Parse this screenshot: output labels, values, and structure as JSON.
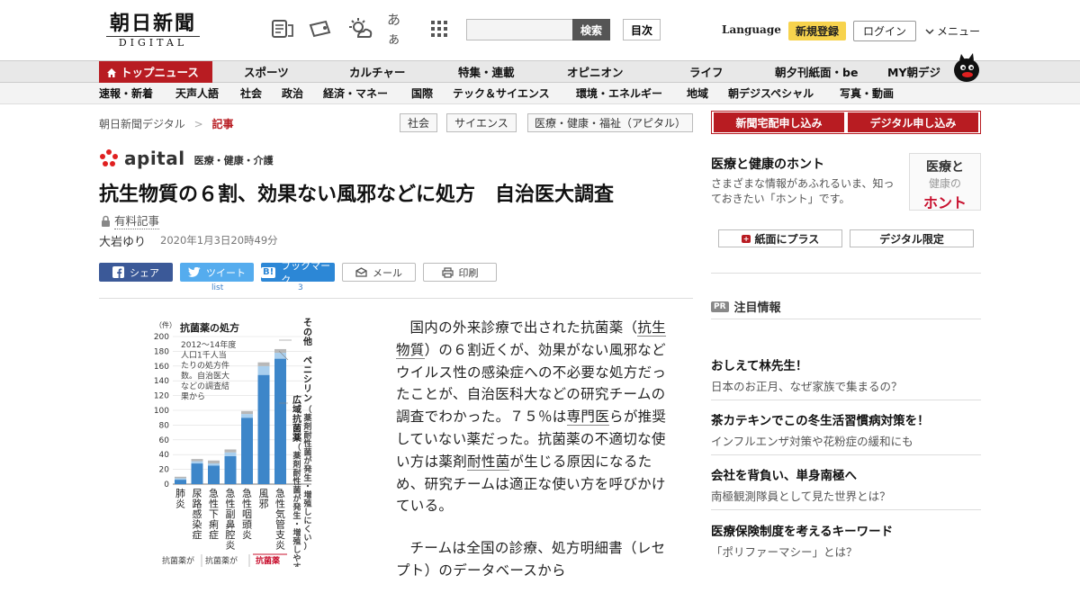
{
  "header": {
    "logo_ja": "朝日新聞",
    "logo_en": "DIGITAL",
    "search_button": "検索",
    "search_placeholder": "",
    "toc_button": "目次",
    "language": "Language",
    "register_button": "新規登録",
    "login_button": "ログイン",
    "menu_button": "メニュー",
    "lang_icon_glyph": "あぁ"
  },
  "nav_primary": [
    "トップニュース",
    "スポーツ",
    "カルチャー",
    "特集・連載",
    "オピニオン",
    "ライフ",
    "朝夕刊紙面・be",
    "MY朝デジ"
  ],
  "nav_secondary": [
    "速報・新着",
    "天声人語",
    "社会",
    "政治",
    "経済・マネー",
    "国際",
    "テック＆サイエンス",
    "環境・エネルギー",
    "地域",
    "朝デジスペシャル",
    "写真・動画"
  ],
  "breadcrumb": {
    "site": "朝日新聞デジタル",
    "sep": ">",
    "current": "記事"
  },
  "tags": [
    "社会",
    "サイエンス",
    "医療・健康・福祉（アピタル）"
  ],
  "apital": {
    "word": "apital",
    "sub": "医療・健康・介護"
  },
  "article": {
    "headline": "抗生物質の６割、効果ない風邪などに処方　自治医大調査",
    "paid_label": "有料記事",
    "author": "大岩ゆり",
    "date": "2020年1月3日20時49分",
    "para1_a": "国内の外来診療で出された抗菌薬（",
    "para1_link1": "抗生物質",
    "para1_b": "）の６割近くが、効果がない風邪などウイルス性の感染症への不必要な処方だったことが、自治医科大などの研究チームの調査でわかった。７５％は",
    "para1_link2": "専門医",
    "para1_c": "らが推奨していない薬だった。抗菌薬の不適切な使い方は薬剤",
    "para1_link3": "耐性菌",
    "para1_d": "が生じる原因になるため、研究チームは適正な使い方を呼びかけている。",
    "para2": "チームは全国の診療、処方明細書（レセプト）のデータベースから"
  },
  "share": {
    "facebook": "シェア",
    "twitter": "ツイート",
    "hatena": "ブックマーク",
    "mail": "メール",
    "print": "印刷",
    "twitter_count": "list",
    "hatena_count": "3"
  },
  "chart_data": {
    "type": "bar",
    "title": "抗菌薬の処方",
    "unit": "（件）",
    "note": [
      "2012～14年度",
      "人口1千人当",
      "たりの処方件",
      "数。自治医大",
      "などの調査結",
      "果から"
    ],
    "ylim": [
      0,
      200
    ],
    "yticks": [
      0,
      20,
      40,
      60,
      80,
      100,
      120,
      140,
      160,
      180,
      200
    ],
    "categories": [
      "肺炎",
      "尿路感染症",
      "急性下痢症",
      "急性副鼻腔炎",
      "急性咽頭炎",
      "風邪",
      "急性気管支炎"
    ],
    "series": [
      {
        "name": "広域抗菌薬",
        "values": [
          6,
          28,
          25,
          38,
          90,
          148,
          170
        ]
      },
      {
        "name": "ペニシリン",
        "values": [
          2,
          3,
          3,
          5,
          5,
          12,
          8
        ]
      },
      {
        "name": "その他",
        "values": [
          2,
          3,
          4,
          4,
          4,
          5,
          5
        ]
      }
    ],
    "legend_labels": {
      "other": "その他",
      "penicillin": "ペニシリン",
      "penicillin_note": "（薬剤耐性菌が発生・増殖しにくい）",
      "broad": "広域抗菌薬",
      "broad_note": "（薬剤耐性菌が発生・増殖しやすい）"
    },
    "bottom_labels": [
      "抗菌薬が",
      "抗菌薬が",
      "抗菌薬"
    ],
    "colors": {
      "broad": "#3d86c9",
      "penicillin": "#a9cfee",
      "other": "#b8b8b8",
      "highlight": "#c8102e"
    }
  },
  "sidebar": {
    "subscribe_paper": "新聞宅配申し込み",
    "subscribe_digital": "デジタル申し込み",
    "honto_title": "医療と健康のホント",
    "honto_desc": "さまざまな情報があふれるいま、知っておきたい「ホント」です。",
    "honto_logo_1": "医療と",
    "honto_logo_2": "健康の",
    "honto_logo_3": "ホント",
    "plus_button": "紙面にプラス",
    "digital_only_button": "デジタル限定",
    "pr_badge": "PR",
    "pr_heading": "注目情報",
    "pr_items": [
      {
        "title": "おしえて林先生！",
        "sub": "日本のお正月、なぜ家族で集まるの？"
      },
      {
        "title": "茶カテキンでこの冬生活習慣病対策を！",
        "sub": "インフルエンザ対策や花粉症の緩和にも"
      },
      {
        "title": "会社を背負い、単身南極へ",
        "sub": "南極観測隊員として見た世界とは？"
      },
      {
        "title": "医療保険制度を考えるキーワード",
        "sub": "「ポリファーマシー」とは？"
      }
    ]
  },
  "colors": {
    "accent": "#b81c22",
    "nav_bg": "#e8e8e8",
    "register": "#f7d34d"
  }
}
